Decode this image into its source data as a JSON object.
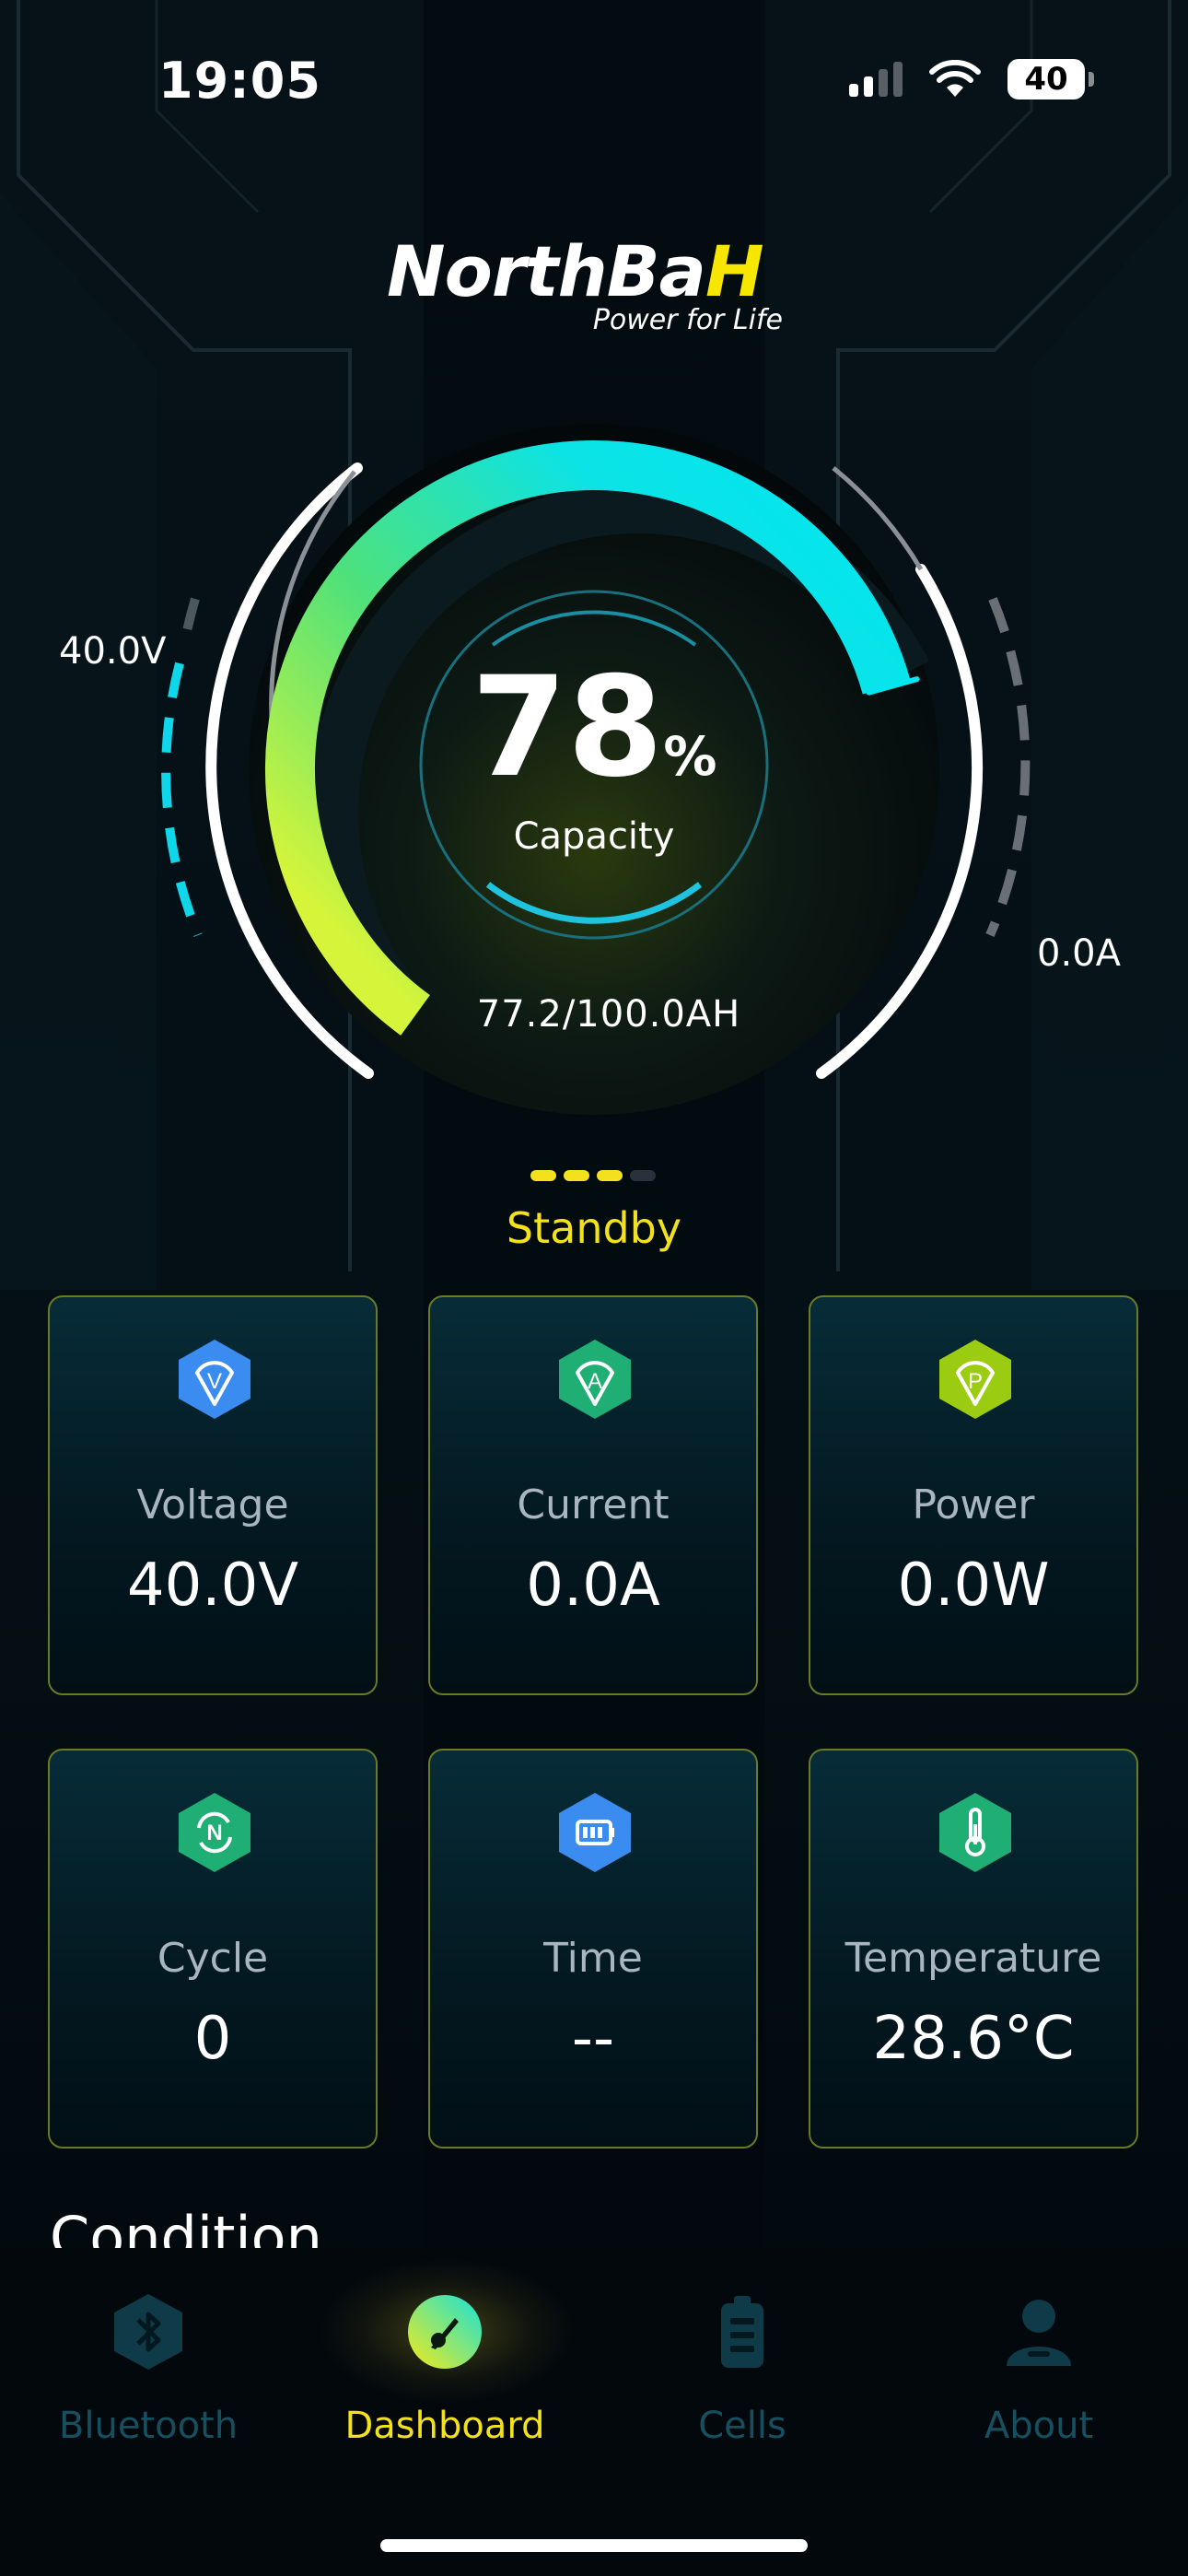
{
  "status_bar": {
    "time": "19:05",
    "battery": "40"
  },
  "brand": {
    "name_main": "NorthBa",
    "name_accent": "H",
    "tagline": "Power for Life"
  },
  "gauge": {
    "capacity_value": "78",
    "capacity_unit": "%",
    "capacity_label": "Capacity",
    "amp_hours": "77.2/100.0AH",
    "voltage_label": "40.0V",
    "current_label": "0.0A",
    "capacity_fraction": 0.78
  },
  "state": {
    "text": "Standby",
    "dots_active": 3,
    "dots_total": 4
  },
  "metrics": [
    {
      "label": "Voltage",
      "value": "40.0V",
      "icon": "voltage-icon",
      "letter": "V",
      "color": "#3b8cf0"
    },
    {
      "label": "Current",
      "value": "0.0A",
      "icon": "current-icon",
      "letter": "A",
      "color": "#1fae73"
    },
    {
      "label": "Power",
      "value": "0.0W",
      "icon": "power-icon",
      "letter": "P",
      "color": "#9ccc12"
    },
    {
      "label": "Cycle",
      "value": "0",
      "icon": "cycle-icon",
      "letter": "N",
      "color": "#1fae73"
    },
    {
      "label": "Time",
      "value": "--",
      "icon": "battery-time-icon",
      "letter": "",
      "color": "#3b8cf0"
    },
    {
      "label": "Temperature",
      "value": "28.6°C",
      "icon": "thermometer-icon",
      "letter": "",
      "color": "#1fae73"
    }
  ],
  "section": {
    "title": "Condition"
  },
  "tabs": [
    {
      "label": "Bluetooth",
      "icon": "bluetooth-icon",
      "active": false
    },
    {
      "label": "Dashboard",
      "icon": "dashboard-icon",
      "active": true
    },
    {
      "label": "Cells",
      "icon": "cells-icon",
      "active": false
    },
    {
      "label": "About",
      "icon": "about-icon",
      "active": false
    }
  ],
  "colors": {
    "accent": "#f2e11c",
    "arc_start": "#d6f53a",
    "arc_end": "#00e6f0",
    "tab_inactive": "#16505f"
  }
}
